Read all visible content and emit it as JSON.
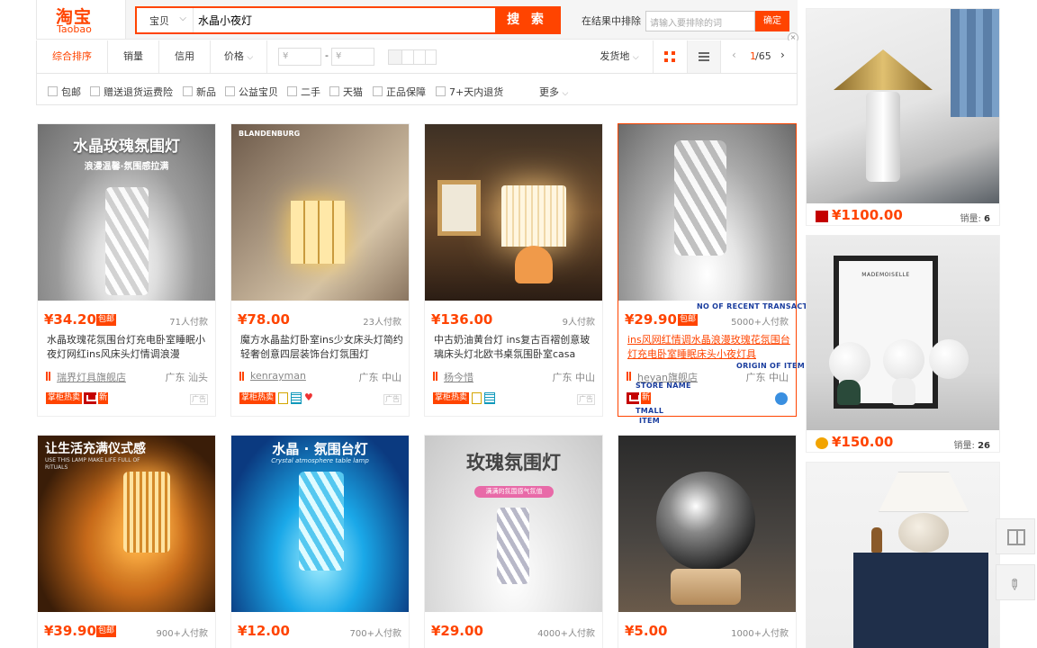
{
  "header": {
    "logo_cn": "淘宝",
    "logo_en": "Taobao",
    "search_category": "宝贝",
    "search_keyword": "水晶小夜灯",
    "search_button": "搜 索",
    "exclude_label": "在结果中排除",
    "exclude_placeholder": "请输入要排除的词",
    "exclude_button": "确定"
  },
  "sortbar": {
    "tabs": [
      "综合排序",
      "销量",
      "信用",
      "价格"
    ],
    "price_from": "¥",
    "price_to": "¥",
    "price_dash": "-",
    "ship_from": "发货地",
    "page": "1",
    "page_total": "/65"
  },
  "filters": [
    "包邮",
    "赠送退货运费险",
    "新品",
    "公益宝贝",
    "二手",
    "天猫",
    "正品保障",
    "7+天内退货"
  ],
  "filters_more": "更多",
  "products": [
    {
      "price": "¥34.20",
      "tag": "包邮",
      "sold": "71人付款",
      "title": "水晶玫瑰花氛围台灯充电卧室睡眠小夜灯网红ins风床头灯情调浪漫",
      "shop": "瑞界灯具旗舰店",
      "location": "广东 汕头",
      "badge": "掌柜热卖",
      "new": "新",
      "img_text": "水晶玫瑰氛围灯",
      "img_sub": "浪漫温馨·氛围感拉满"
    },
    {
      "price": "¥78.00",
      "sold": "23人付款",
      "title": "魔方水晶盐灯卧室ins少女床头灯简约轻奢创意四层装饰台灯氛围灯",
      "shop": "kenrayman",
      "location": "广东 中山",
      "badge": "掌柜热卖",
      "img_text": "BLANDENBURG"
    },
    {
      "price": "¥136.00",
      "sold": "9人付款",
      "title": "中古奶油黄台灯 ins复古百褶创意玻璃床头灯北欧书桌氛围卧室casa",
      "shop": "杨今惜",
      "location": "广东 中山",
      "badge": "掌柜热卖"
    },
    {
      "price": "¥29.90",
      "tag": "包邮",
      "sold": "5000+人付款",
      "title": "ins风网红情调水晶浪漫玫瑰花氛围台灯充电卧室睡眠床头小夜灯具",
      "shop": "heyan旗舰店",
      "location": "广东 中山",
      "new": "新"
    },
    {
      "price": "¥39.90",
      "tag": "包邮",
      "sold": "900+人付款",
      "img_text": "让生活充满仪式感",
      "img_sub": "USE THIS LAMP MAKE LIFE FULL OF RITUALS"
    },
    {
      "price": "¥12.00",
      "sold": "700+人付款",
      "img_text": "水晶 · 氛围台灯",
      "img_sub": "Crystal atmosphere table lamp"
    },
    {
      "price": "¥29.00",
      "sold": "4000+人付款",
      "img_text": "玫瑰氛围灯",
      "img_sub": "满满的氛围感气氛值"
    },
    {
      "price": "¥5.00",
      "sold": "1000+人付款"
    }
  ],
  "annotations": {
    "no_recent": "NO OF RECENT TRANSACTIONS",
    "origin": "ORIGIN OF ITEM",
    "store": "STORE NAME",
    "tmall": "TMALL",
    "item": "ITEM"
  },
  "right": [
    {
      "price": "¥1100.00",
      "sales_label": "销量:",
      "sales": "6"
    },
    {
      "price": "¥150.00",
      "sales_label": "销量:",
      "sales": "26",
      "img_text": "MADEMOISELLE"
    },
    {}
  ],
  "ad_label": "广告"
}
